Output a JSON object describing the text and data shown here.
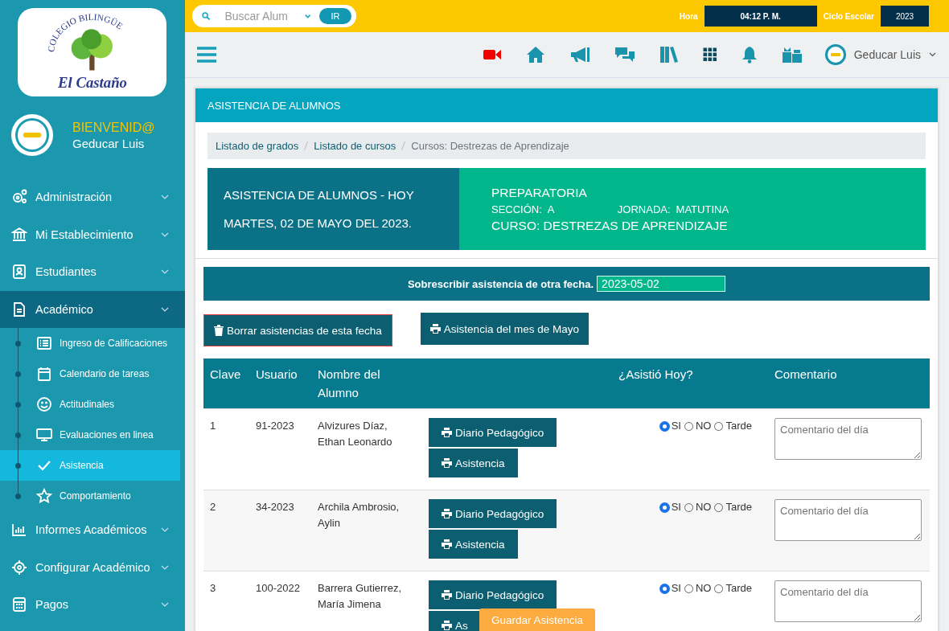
{
  "sidebar": {
    "logo": {
      "arc_text": "COLEGIO BILINGÜE",
      "name": "El Castaño"
    },
    "user": {
      "greeting": "BIENVENID@",
      "name": "Geducar Luis"
    },
    "menu": [
      {
        "label": "Administración",
        "selected": false
      },
      {
        "label": "Mi Establecimiento",
        "selected": false
      },
      {
        "label": "Estudiantes",
        "selected": false
      },
      {
        "label": "Académico",
        "expanded": true,
        "selected": true,
        "children": [
          {
            "label": "Ingreso de Calificaciones",
            "selected": false
          },
          {
            "label": "Calendario de tareas",
            "selected": false
          },
          {
            "label": "Actitudinales",
            "selected": false
          },
          {
            "label": "Evaluaciones en linea",
            "selected": false
          },
          {
            "label": "Asistencia",
            "selected": true
          },
          {
            "label": "Comportamiento",
            "selected": false
          }
        ]
      },
      {
        "label": "Informes Académicos",
        "selected": false
      },
      {
        "label": "Configurar Académico",
        "selected": false
      },
      {
        "label": "Pagos",
        "selected": false
      }
    ]
  },
  "topbar": {
    "search": {
      "placeholder": "Buscar Alum",
      "button": "IR"
    },
    "hora_label": "Hora",
    "hora": "04:12 P. M.",
    "ciclo_label": "Ciclo Escolar",
    "ciclo": "2023"
  },
  "toolbar": {
    "user": "Geducar Luis"
  },
  "panel": {
    "title": "ASISTENCIA DE ALUMNOS",
    "breadcrumb": [
      {
        "label": "Listado de grados",
        "link": true
      },
      {
        "label": "Listado de cursos",
        "link": true
      },
      {
        "label": "Cursos: Destrezas de Aprendizaje",
        "link": false
      }
    ],
    "banner": {
      "heading": "ASISTENCIA DE ALUMNOS - HOY",
      "date": "MARTES, 02 DE MAYO DEL 2023.",
      "grade": "PREPARATORIA",
      "section_label": "SECCIÓN:",
      "section": "A",
      "shift_label": "JORNADA:",
      "shift": "MATUTINA",
      "course": "CURSO: DESTREZAS DE APRENDIZAJE"
    },
    "override": {
      "label": "Sobrescribir asistencia de otra fecha.",
      "date": "2023-05-02"
    },
    "actions": [
      "Borrar asistencias de esta fecha",
      "Asistencia del mes de Mayo"
    ],
    "table": {
      "columns": [
        "Clave",
        "Usuario",
        "Nombre del Alumno",
        "¿Asistió Hoy?",
        "Comentario"
      ],
      "rows": [
        {
          "clave": "1",
          "usuario": "91-2023",
          "nombre": "Alvizures Díaz, Ethan Leonardo",
          "buttons": [
            "Diario Pedagógico",
            "Asistencia"
          ],
          "attendance": [
            {
              "label": "SI",
              "selected": true
            },
            {
              "label": "NO",
              "selected": false
            },
            {
              "label": "Tarde",
              "selected": false
            }
          ],
          "comment_placeholder": "Comentario del día"
        },
        {
          "clave": "2",
          "usuario": "34-2023",
          "nombre": "Archila Ambrosio, Aylin",
          "buttons": [
            "Diario Pedagógico",
            "Asistencia"
          ],
          "attendance": [
            {
              "label": "SI",
              "selected": true
            },
            {
              "label": "NO",
              "selected": false
            },
            {
              "label": "Tarde",
              "selected": false
            }
          ],
          "comment_placeholder": "Comentario del día"
        },
        {
          "clave": "3",
          "usuario": "100-2022",
          "nombre": "Barrera Gutierrez, María Jimena",
          "buttons": [
            "Diario Pedagógico",
            "As"
          ],
          "attendance": [
            {
              "label": "SI",
              "selected": true
            },
            {
              "label": "NO",
              "selected": false
            },
            {
              "label": "Tarde",
              "selected": false
            }
          ],
          "comment_placeholder": "Comentario del día"
        }
      ]
    },
    "save_button": "Guardar Asistencia"
  }
}
